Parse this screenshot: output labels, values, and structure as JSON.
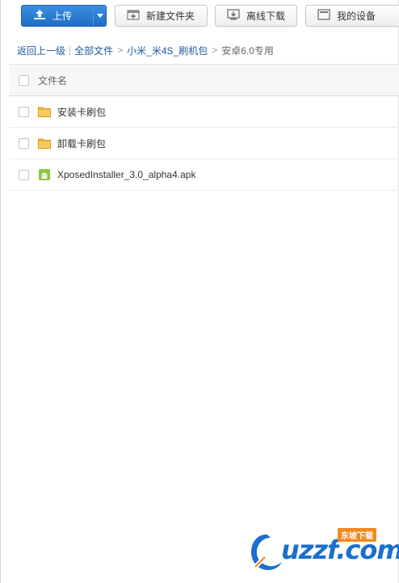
{
  "toolbar": {
    "upload_label": "上传",
    "new_folder_label": "新建文件夹",
    "offline_download_label": "离线下载",
    "my_devices_label": "我的设备"
  },
  "breadcrumb": {
    "back": "返回上一级",
    "all_files": "全部文件",
    "folder1": "小米_米4S_刷机包",
    "current": "安卓6.0专用"
  },
  "list": {
    "column_header": "文件名",
    "items": [
      {
        "name": "安装卡刷包",
        "type": "folder"
      },
      {
        "name": "卸载卡刷包",
        "type": "folder"
      },
      {
        "name": "XposedInstaller_3.0_alpha4.apk",
        "type": "apk"
      }
    ]
  },
  "watermark": {
    "brand": "uzzf.com",
    "badge": "东坡下载"
  },
  "colors": {
    "accent": "#2b7fd8",
    "link": "#1e5c9e",
    "folder": "#f2b233",
    "android": "#8cc63f"
  }
}
